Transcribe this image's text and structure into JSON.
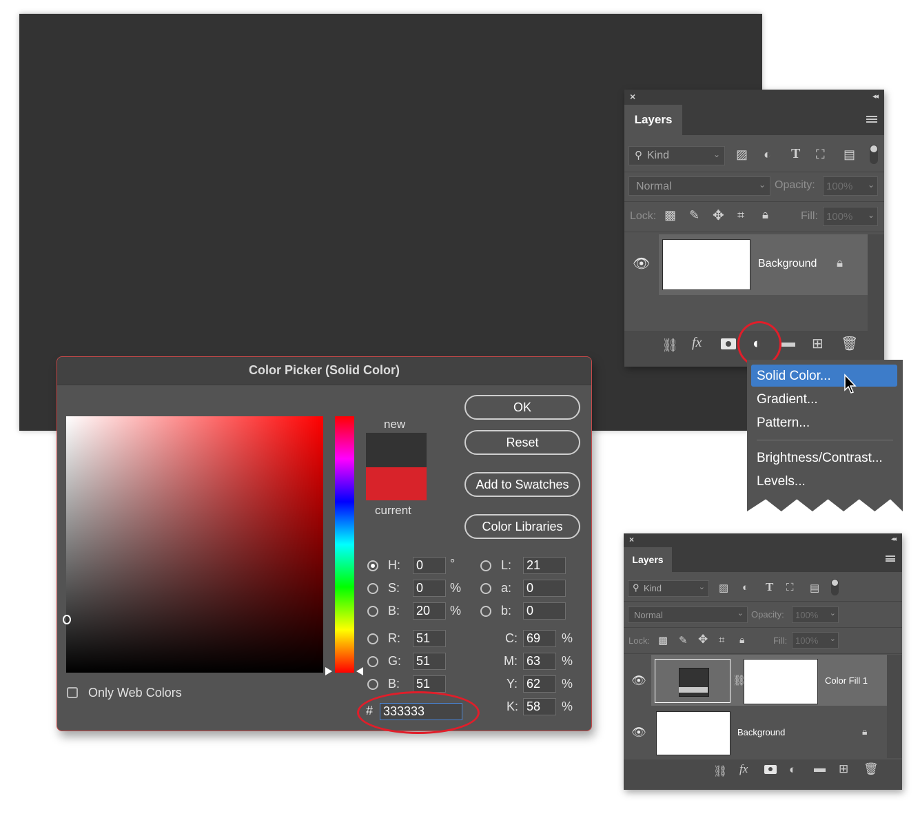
{
  "colors": {
    "canvas": "#333333",
    "current_swatch": "#d8232a",
    "new_swatch": "#333333",
    "highlight": "#3d7cc9",
    "annotation": "#e01e2a"
  },
  "layers_panel_top": {
    "tab": "Layers",
    "kind_placeholder": "Kind",
    "blend_mode": "Normal",
    "opacity_label": "Opacity:",
    "opacity_value": "100%",
    "lock_label": "Lock:",
    "fill_label": "Fill:",
    "fill_value": "100%",
    "layer_name": "Background"
  },
  "adjustment_menu": {
    "items": [
      "Solid Color...",
      "Gradient...",
      "Pattern...",
      "Brightness/Contrast...",
      "Levels..."
    ],
    "selected": "Solid Color..."
  },
  "color_picker": {
    "title": "Color Picker (Solid Color)",
    "new_label": "new",
    "current_label": "current",
    "buttons": {
      "ok": "OK",
      "reset": "Reset",
      "add_to_swatches": "Add to Swatches",
      "color_libraries": "Color Libraries"
    },
    "only_web_colors": "Only Web Colors",
    "hsb": {
      "h_label": "H:",
      "h": "0",
      "h_unit": "°",
      "s_label": "S:",
      "s": "0",
      "s_unit": "%",
      "b_label": "B:",
      "b": "20",
      "b_unit": "%"
    },
    "lab": {
      "l_label": "L:",
      "l": "21",
      "a_label": "a:",
      "a": "0",
      "b_label": "b:",
      "b": "0"
    },
    "rgb": {
      "r_label": "R:",
      "r": "51",
      "g_label": "G:",
      "g": "51",
      "b_label": "B:",
      "b": "51"
    },
    "cmyk": {
      "c_label": "C:",
      "c": "69",
      "m_label": "M:",
      "m": "63",
      "y_label": "Y:",
      "y": "62",
      "k_label": "K:",
      "k": "58",
      "unit": "%"
    },
    "hex_label": "#",
    "hex": "333333"
  },
  "layers_panel_bottom": {
    "tab": "Layers",
    "kind_placeholder": "Kind",
    "blend_mode": "Normal",
    "opacity_label": "Opacity:",
    "opacity_value": "100%",
    "lock_label": "Lock:",
    "fill_label": "Fill:",
    "fill_value": "100%",
    "layers": [
      "Color Fill 1",
      "Background"
    ]
  }
}
